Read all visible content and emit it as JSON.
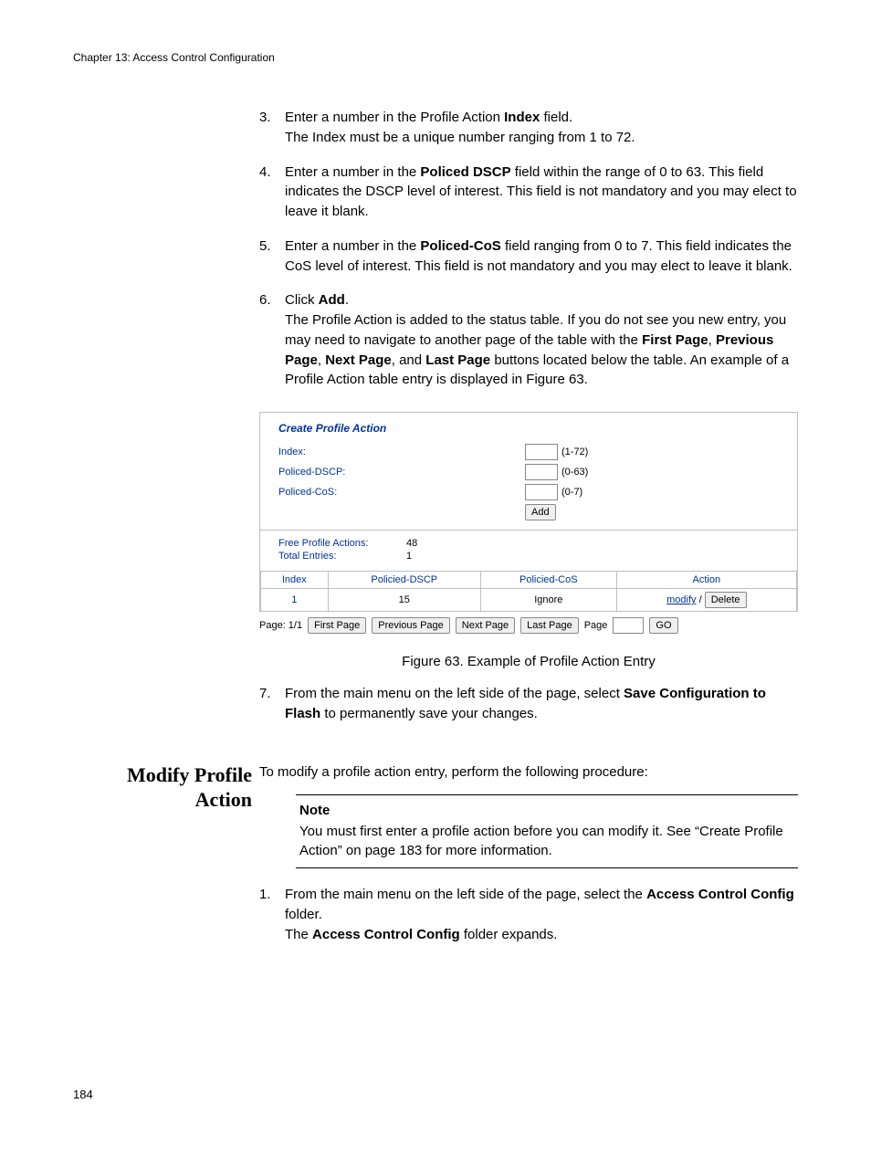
{
  "chapter": "Chapter 13: Access Control Configuration",
  "steps_a": [
    {
      "n": "3.",
      "html": "Enter a number in the Profile Action <b>Index</b> field.<br>The Index must be a unique number ranging from 1 to 72."
    },
    {
      "n": "4.",
      "html": "Enter a number in the <b>Policed DSCP</b> field within the range of 0 to 63. This field indicates the DSCP level of interest. This field is not mandatory and you may elect to leave it blank."
    },
    {
      "n": "5.",
      "html": "Enter a number in the <b>Policed-CoS</b> field ranging from 0 to 7. This field indicates the CoS level of interest. This field is not mandatory and you may elect to leave it blank."
    },
    {
      "n": "6.",
      "html": "Click <b>Add</b>.<br>The Profile Action is added to the status table. If you do not see you new entry, you may need to navigate to another page of the table with the <b>First Page</b>, <b>Previous Page</b>, <b>Next Page</b>, and <b>Last Page</b> buttons located below the table. An example of a Profile Action table entry is displayed in Figure 63."
    }
  ],
  "panel": {
    "title": "Create Profile Action",
    "fields": [
      {
        "label": "Index:",
        "range": "(1-72)"
      },
      {
        "label": "Policed-DSCP:",
        "range": "(0-63)"
      },
      {
        "label": "Policed-CoS:",
        "range": "(0-7)"
      }
    ],
    "add": "Add",
    "stats": [
      {
        "label": "Free Profile Actions:",
        "value": "48"
      },
      {
        "label": "Total Entries:",
        "value": "1"
      }
    ],
    "table": {
      "headers": [
        "Index",
        "Policied-DSCP",
        "Policied-CoS",
        "Action"
      ],
      "row": [
        "1",
        "15",
        "Ignore"
      ],
      "modify": "modify",
      "sep": " / ",
      "delete": "Delete"
    },
    "pager": {
      "page_label": "Page: 1/1",
      "first": "First Page",
      "prev": "Previous Page",
      "next": "Next Page",
      "last": "Last Page",
      "page_word": "Page",
      "go": "GO"
    }
  },
  "fig_caption": "Figure 63. Example of Profile Action Entry",
  "steps_b": [
    {
      "n": "7.",
      "html": "From the main menu on the left side of the page, select <b>Save Configuration to Flash</b> to permanently save your changes."
    }
  ],
  "section_heading": "Modify Profile Action",
  "section_intro": "To modify a profile action entry, perform the following procedure:",
  "note": {
    "title": "Note",
    "body": "You must first enter a profile action before you can modify it. See “Create Profile Action” on page 183 for more information."
  },
  "steps_c": [
    {
      "n": "1.",
      "html": "From the main menu on the left side of the page, select the <b>Access Control Config</b> folder.<br>The <b>Access Control Config</b> folder expands."
    }
  ],
  "page_number": "184"
}
